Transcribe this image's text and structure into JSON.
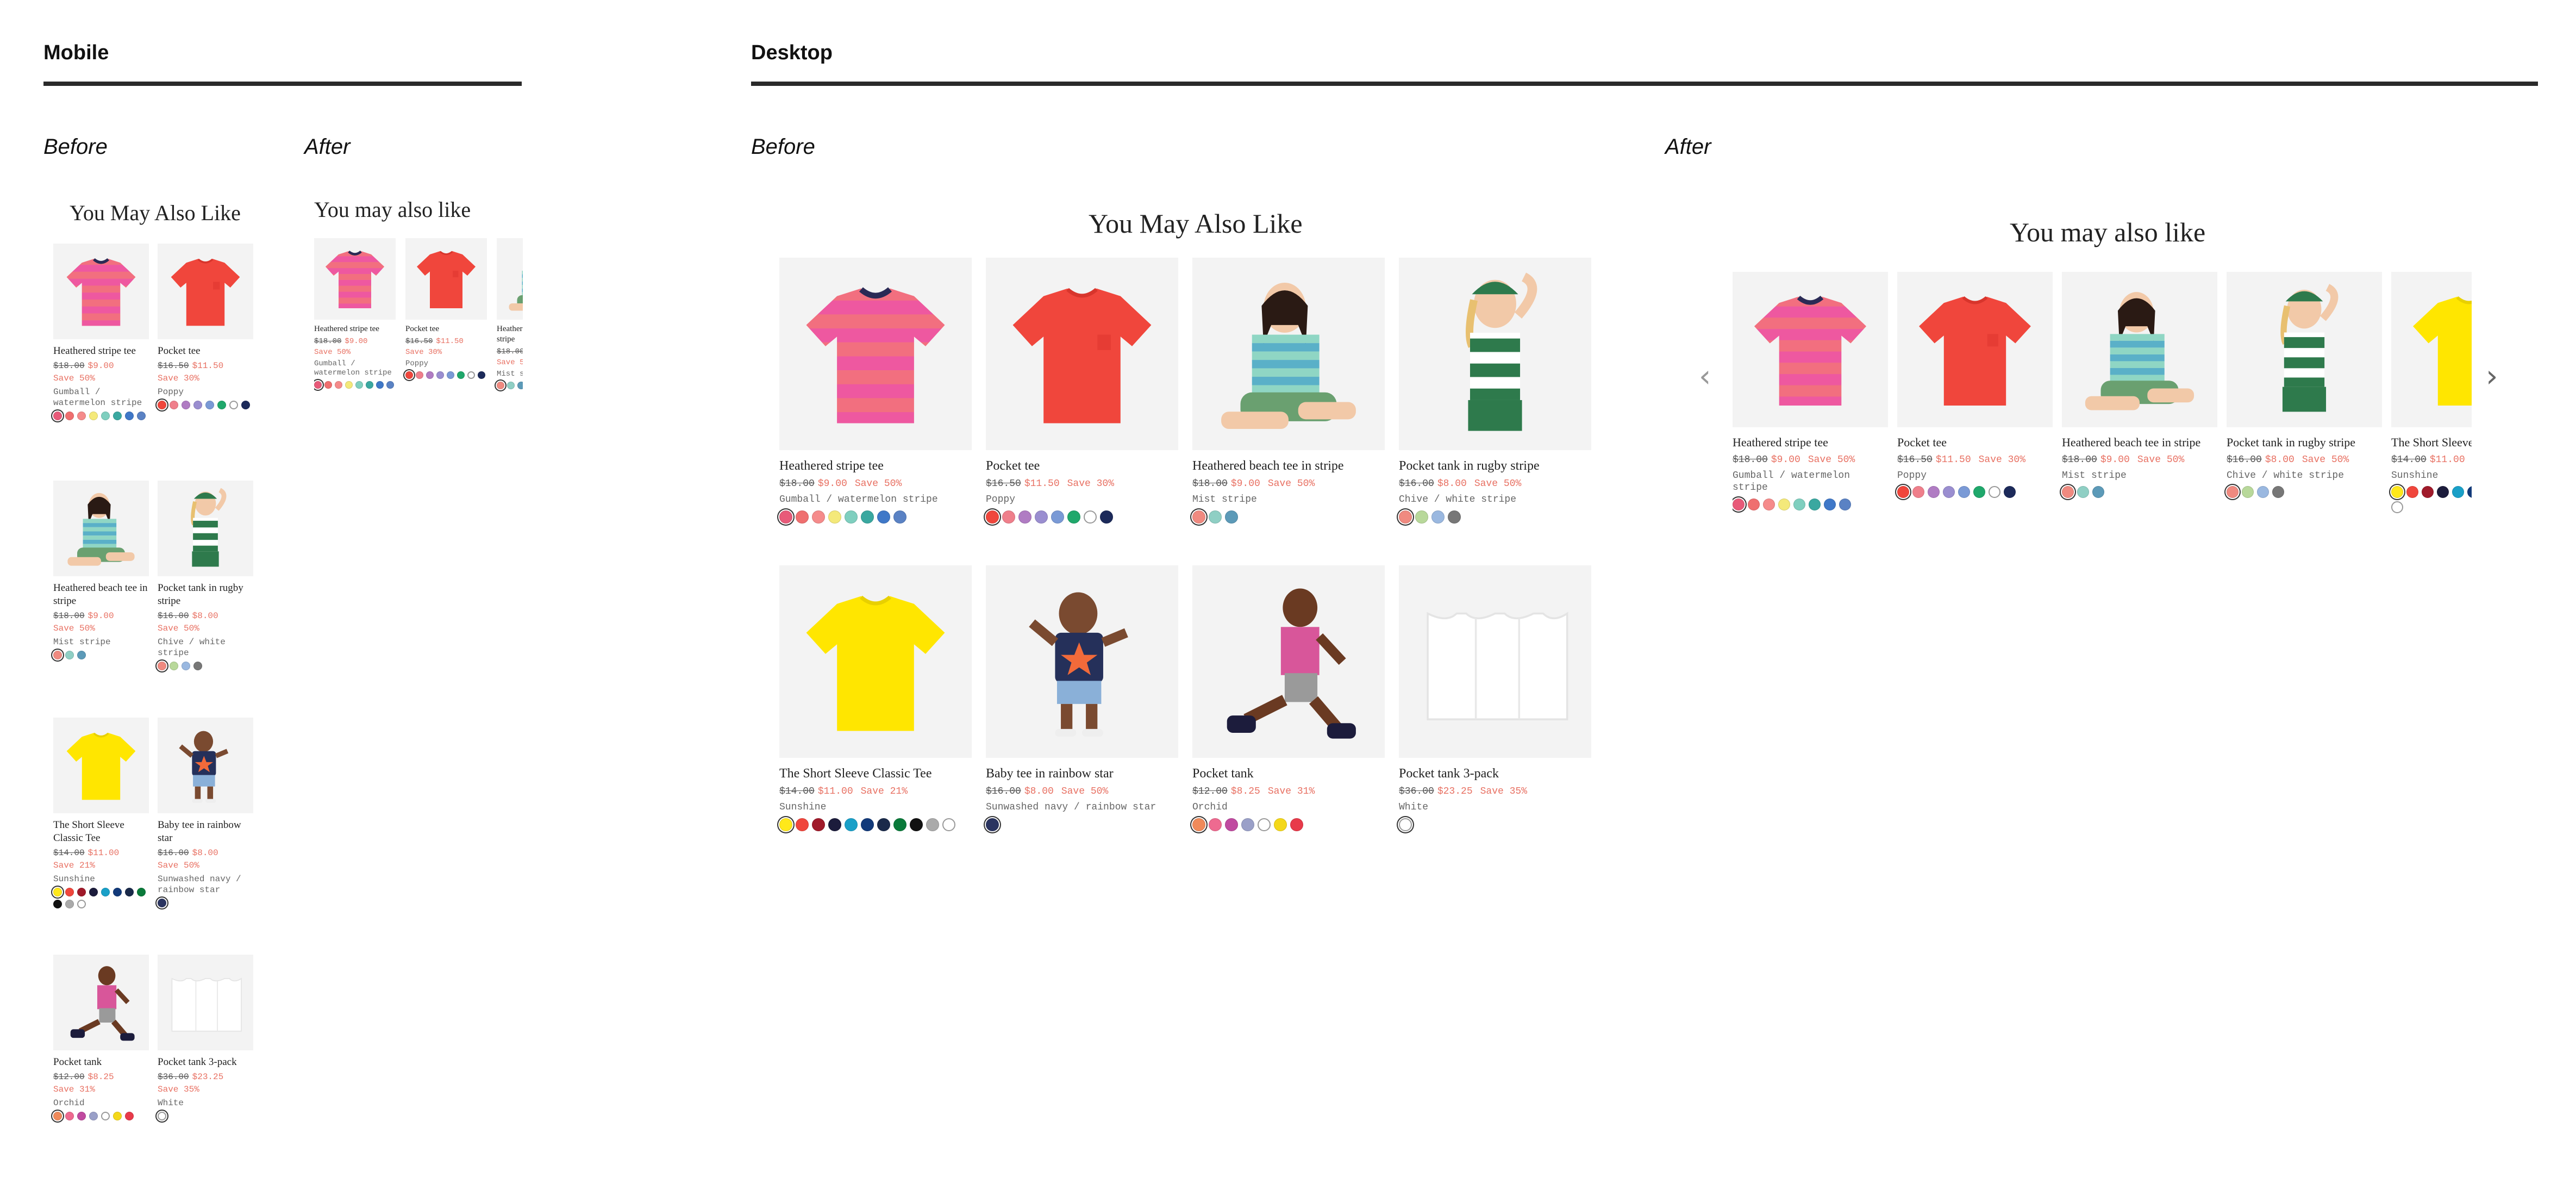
{
  "sections": {
    "mobile": "Mobile",
    "desktop": "Desktop"
  },
  "labels": {
    "before": "Before",
    "after": "After"
  },
  "headings": {
    "before": "You May Also Like",
    "after": "You may also like"
  },
  "arrows": {
    "prev": "‹",
    "next": "›"
  },
  "accent_color": "#e87062",
  "products": [
    {
      "name": "Heathered stripe tee",
      "was": "$18.00",
      "now": "$9.00",
      "save": "Save 50%",
      "color": "Gumball / watermelon stripe",
      "swatches": [
        "#e85a79",
        "#ef6f6f",
        "#f58b8b",
        "#f4e97a",
        "#7fcfbf",
        "#3aa8a0",
        "#3f78c8",
        "#5a82c4"
      ],
      "image": "pink-stripe-tee"
    },
    {
      "name": "Pocket tee",
      "was": "$16.50",
      "now": "$11.50",
      "save": "Save 30%",
      "color": "Poppy",
      "swatches": [
        "#f0463c",
        "#ef7f8b",
        "#b07cc3",
        "#9a8ed0",
        "#7a9ad6",
        "#1fa86b",
        "#ffffff",
        "#1c2a5a"
      ],
      "image": "red-tee"
    },
    {
      "name": "Heathered beach tee in stripe",
      "was": "$18.00",
      "now": "$9.00",
      "save": "Save 50%",
      "color": "Mist stripe",
      "swatches": [
        "#f08a80",
        "#8fcfc4",
        "#5c9ab8"
      ],
      "image": "girl-beach-tee"
    },
    {
      "name": "Pocket tank in rugby stripe",
      "was": "$16.00",
      "now": "$8.00",
      "save": "Save 50%",
      "color": "Chive / white stripe",
      "swatches": [
        "#f08a80",
        "#b8d89a",
        "#9ab8e0",
        "#777777"
      ],
      "image": "girl-rugby-tank"
    },
    {
      "name": "The Short Sleeve Classic Tee",
      "was": "$14.00",
      "now": "$11.00",
      "save": "Save 21%",
      "color": "Sunshine",
      "swatches": [
        "#ffe81a",
        "#f0463c",
        "#a01a2a",
        "#1c1c3c",
        "#1aa0c8",
        "#123a7a",
        "#1a2a4a",
        "#0a7a3a",
        "#111111",
        "#aaaaaa",
        "#ffffff"
      ],
      "image": "yellow-tee"
    },
    {
      "name": "Baby tee in rainbow star",
      "was": "$16.00",
      "now": "$8.00",
      "save": "Save 50%",
      "color": "Sunwashed navy / rainbow star",
      "swatches": [
        "#2a3460"
      ],
      "image": "baby-rainbow-star"
    },
    {
      "name": "Pocket tank",
      "was": "$12.00",
      "now": "$8.25",
      "save": "Save 31%",
      "color": "Orchid",
      "swatches": [
        "#f08a5a",
        "#ee6a90",
        "#c04aa0",
        "#9aa0c8",
        "#ffffff",
        "#f4d81a",
        "#e83a4a"
      ],
      "image": "boy-pink-tank"
    },
    {
      "name": "Pocket tank 3-pack",
      "was": "$36.00",
      "now": "$23.25",
      "save": "Save 35%",
      "color": "White",
      "swatches": [
        "#ffffff"
      ],
      "image": "white-tank-pack"
    }
  ]
}
